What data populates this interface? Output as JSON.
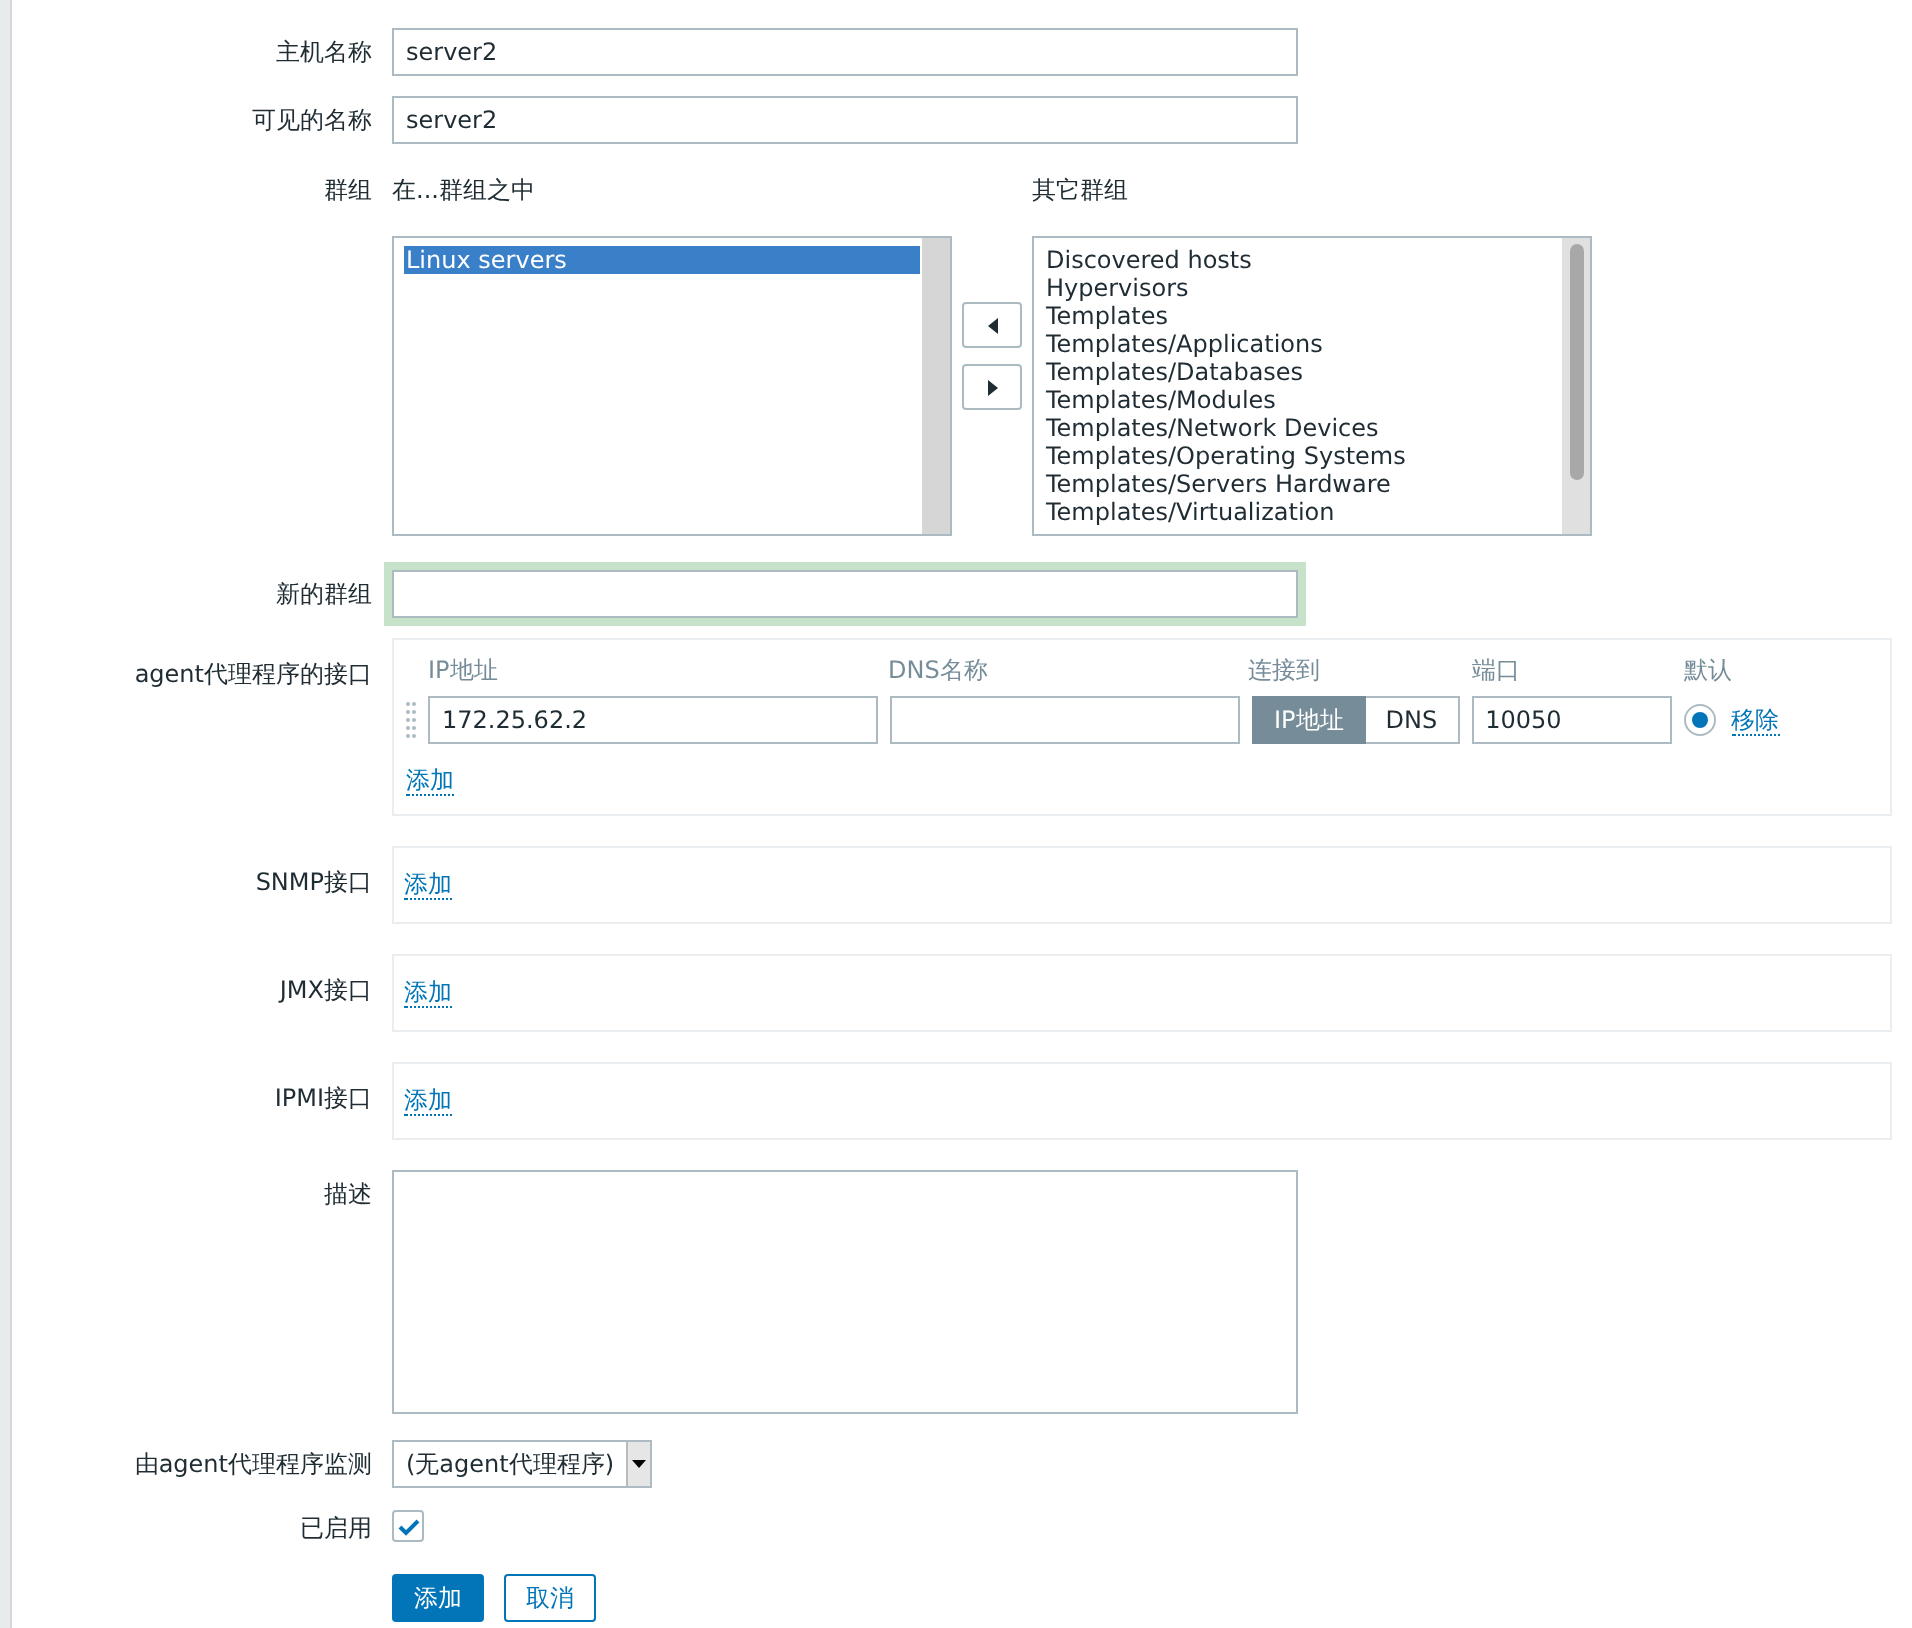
{
  "fields": [
    {
      "label": "主机名称",
      "value": "server2"
    },
    {
      "label": "可见的名称",
      "value": "server2"
    }
  ],
  "groups": {
    "label": "群组",
    "in_title": "在...群组之中",
    "in_groups": [
      {
        "text": "Linux servers",
        "selected": true
      }
    ],
    "other_title": "其它群组",
    "other_groups": [
      {
        "text": "Discovered hosts",
        "selected": false
      },
      {
        "text": "Hypervisors",
        "selected": false
      },
      {
        "text": "Templates",
        "selected": false
      },
      {
        "text": "Templates/Applications",
        "selected": false
      },
      {
        "text": "Templates/Databases",
        "selected": false
      },
      {
        "text": "Templates/Modules",
        "selected": false
      },
      {
        "text": "Templates/Network Devices",
        "selected": false
      },
      {
        "text": "Templates/Operating Systems",
        "selected": false
      },
      {
        "text": "Templates/Servers Hardware",
        "selected": false
      },
      {
        "text": "Templates/Virtualization",
        "selected": false
      }
    ]
  },
  "new_group": {
    "label": "新的群组",
    "focused": true
  },
  "interfaces": [
    {
      "label": "agent代理程序的接口",
      "columns": [
        "IP地址",
        "DNS名称",
        "连接到",
        "端口",
        "默认"
      ],
      "rows": [
        {
          "ip": "172.25.62.2",
          "connect_options": [
            {
              "text": "IP地址",
              "selected": true
            },
            {
              "text": "DNS",
              "selected": false
            }
          ],
          "port": "10050",
          "default": true,
          "remove": "移除"
        }
      ],
      "add": "添加"
    },
    {
      "label": "SNMP接口",
      "add": "添加"
    },
    {
      "label": "JMX接口",
      "add": "添加"
    },
    {
      "label": "IPMI接口",
      "add": "添加"
    }
  ],
  "description": {
    "label": "描述"
  },
  "proxy": {
    "label": "由agent代理程序监测",
    "value": "(无agent代理程序)"
  },
  "enabled": {
    "label": "已启用",
    "checked": true
  },
  "buttons": [
    {
      "text": "添加",
      "kind": "primary"
    },
    {
      "text": "取消",
      "kind": "secondary"
    }
  ]
}
